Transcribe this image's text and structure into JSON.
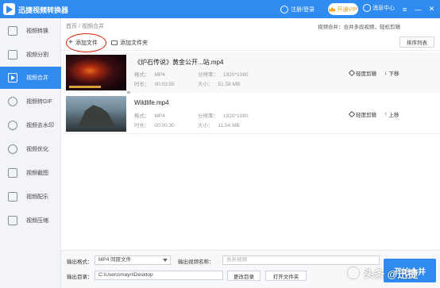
{
  "app": {
    "title": "迅捷视频转换器"
  },
  "titlebar": {
    "user_label": "注册/登录",
    "vip_label": "开通VIP",
    "msg_label": "消息中心",
    "menu_glyph": "≡",
    "min_glyph": "—",
    "close_glyph": "✕"
  },
  "sidebar": {
    "items": [
      {
        "label": "视频转换"
      },
      {
        "label": "视频分割"
      },
      {
        "label": "视频合并"
      },
      {
        "label": "视频转GIF"
      },
      {
        "label": "视频去水印"
      },
      {
        "label": "视频优化"
      },
      {
        "label": "视频截图"
      },
      {
        "label": "视频配乐"
      },
      {
        "label": "视频压缩"
      }
    ],
    "active_index": 2
  },
  "breadcrumb": {
    "home": "首页",
    "sep": "/",
    "current": "视频合并"
  },
  "tip": "视频合并：合并多段视频，轻松剪辑",
  "toolbar": {
    "add_file": "添加文件",
    "add_folder": "添加文件夹",
    "sort": "排序列表"
  },
  "files": [
    {
      "name": "《炉石传说》黄金公开...站.mp4",
      "format_label": "格式：",
      "format": "MP4",
      "res_label": "分辨率：",
      "resolution": "1920*1080",
      "dur_label": "时长：",
      "duration": "00:03:56",
      "size_label": "大小：",
      "size": "51.58 MB",
      "edit": "轻度剪辑",
      "move": "下移",
      "move_glyph": "↓"
    },
    {
      "name": "Wildlife.mp4",
      "format_label": "格式：",
      "format": "MP4",
      "res_label": "分辨率：",
      "resolution": "1920*1080",
      "dur_label": "时长：",
      "duration": "00:00:30",
      "size_label": "大小：",
      "size": "11.54 MB",
      "edit": "轻度剪辑",
      "move": "上移",
      "move_glyph": "↑"
    }
  ],
  "bottom": {
    "format_label": "输出格式：",
    "format_value": "MP4  同原文件",
    "name_label": "输出视频名称：",
    "name_placeholder": "合并视频",
    "dir_label": "输出目录：",
    "dir_value": "C:\\Users\\mayn\\Desktop",
    "change_dir": "更改目录",
    "open_folder": "打开文件夹",
    "merge": "开始合并"
  },
  "watermark": "头条 @迅捷"
}
